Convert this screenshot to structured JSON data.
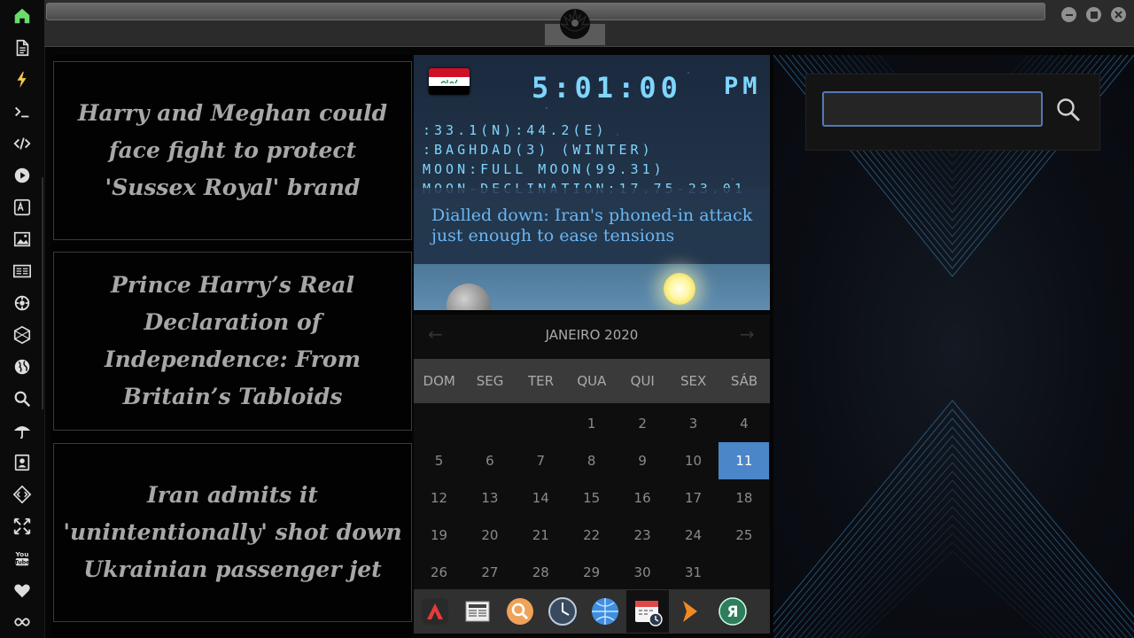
{
  "sidebar": {
    "icons": [
      "home-icon",
      "document-icon",
      "bolt-icon",
      "terminal-icon",
      "code-icon",
      "play-icon",
      "translate-icon",
      "image-icon",
      "news-icon",
      "settings-cog-icon",
      "hexagon-icon",
      "globe-icon",
      "search-icon",
      "umbrella-icon",
      "contacts-icon",
      "dev-tools-icon",
      "fullscreen-icon",
      "youtube-icon",
      "heart-icon",
      "infinity-icon"
    ]
  },
  "news": {
    "items": [
      {
        "title": "Harry and Meghan could face fight to protect 'Sussex Royal' brand"
      },
      {
        "title": "Prince Harry’s Real Declaration of Independence: From Britain’s Tabloids"
      },
      {
        "title": "Iran admits it 'unintentionally' shot down Ukrainian passenger jet"
      }
    ]
  },
  "clock": {
    "time": "5:01:00",
    "ampm": "PM",
    "coords": ":33.1(N):44.2(E)",
    "location": ":BAGHDAD(3) (WINTER)",
    "moon": "MOON:FULL MOON(99.31)",
    "declination": "MOON-DECLINATION:17.75-23.01",
    "headline": "Dialled down: Iran's phoned-in attack just enough to ease tensions",
    "flag_colors": [
      "#ce1126",
      "#ffffff",
      "#000000"
    ]
  },
  "calendar": {
    "title": "JANEIRO 2020",
    "weekdays": [
      "DOM",
      "SEG",
      "TER",
      "QUA",
      "QUI",
      "SEX",
      "SÁB"
    ],
    "first_weekday_index": 3,
    "days_in_month": 31,
    "today": 11,
    "accent_color": "#4b86c8"
  },
  "dock": {
    "items": [
      "app-a-icon",
      "news-app-icon",
      "search-app-icon",
      "clock-app-icon",
      "globe-app-icon",
      "calendar-app-icon",
      "arrow-app-icon",
      "yandex-app-icon"
    ],
    "active_index": 5
  },
  "search": {
    "placeholder": "",
    "value": ""
  }
}
